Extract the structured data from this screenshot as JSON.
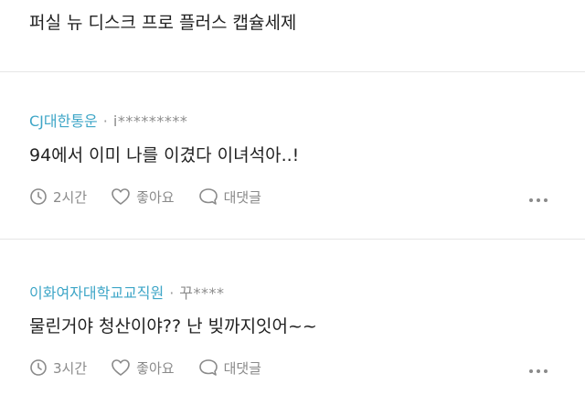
{
  "top_comment": {
    "text": "퍼실 뉴 디스크 프로 플러스 캡슐세제"
  },
  "comments": [
    {
      "company": "CJ대한통운",
      "separator": "·",
      "user": "i*********",
      "text": "94에서 이미 나를 이겼다 이녀석아..!",
      "time": "2시간",
      "like_label": "좋아요",
      "reply_label": "대댓글"
    },
    {
      "company": "이화여자대학교교직원",
      "separator": "·",
      "user": "꾸****",
      "text": "물린거야 청산이야?? 난 빚까지잇어~~",
      "time": "3시간",
      "like_label": "좋아요",
      "reply_label": "대댓글"
    }
  ],
  "colors": {
    "company": "#3ea6c7",
    "meta": "#8a8a8a",
    "text": "#222222",
    "divider": "#e6e6e6"
  },
  "icons": [
    "clock-icon",
    "heart-icon",
    "speech-bubble-icon",
    "more-dots-icon"
  ]
}
